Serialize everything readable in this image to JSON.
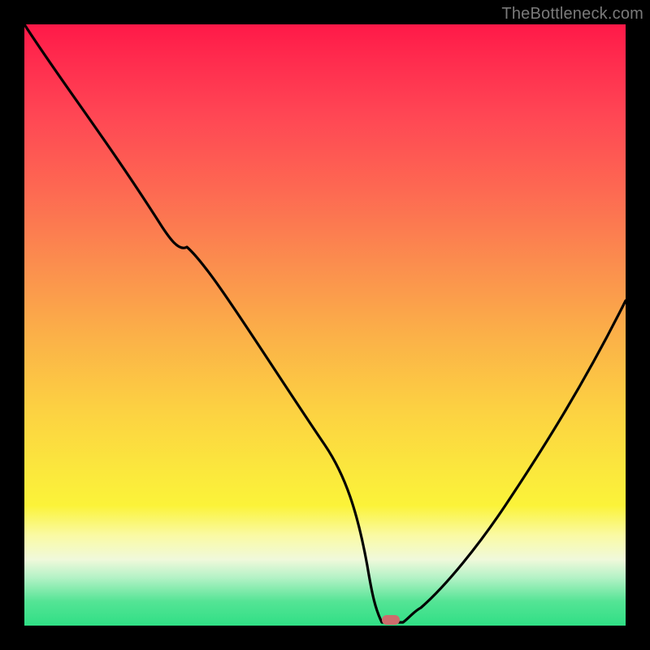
{
  "watermark": "TheBottleneck.com",
  "chart_data": {
    "type": "line",
    "title": "",
    "xlabel": "",
    "ylabel": "",
    "xlim": [
      0,
      100
    ],
    "ylim": [
      0,
      100
    ],
    "grid": false,
    "legend": false,
    "annotations": [],
    "series": [
      {
        "name": "bottleneck-curve",
        "x": [
          0,
          8,
          16,
          24,
          27,
          34,
          42,
          50,
          55,
          57,
          58,
          60,
          61,
          63,
          66,
          72,
          80,
          88,
          96,
          100
        ],
        "y": [
          100,
          88,
          77,
          66,
          63,
          56,
          44,
          30,
          18,
          10,
          4,
          0,
          0,
          0,
          3,
          9,
          20,
          33,
          47,
          54
        ]
      }
    ],
    "marker": {
      "x": 60.5,
      "y": 0.6,
      "color": "#cd6c6c"
    },
    "background_gradient_stops": [
      {
        "pos": 0.0,
        "color": "#ff1948"
      },
      {
        "pos": 0.06,
        "color": "#ff2c4e"
      },
      {
        "pos": 0.15,
        "color": "#ff4654"
      },
      {
        "pos": 0.28,
        "color": "#fd6a52"
      },
      {
        "pos": 0.4,
        "color": "#fb8e4e"
      },
      {
        "pos": 0.52,
        "color": "#fbb148"
      },
      {
        "pos": 0.64,
        "color": "#fcd142"
      },
      {
        "pos": 0.74,
        "color": "#fbe73d"
      },
      {
        "pos": 0.8,
        "color": "#fbf339"
      },
      {
        "pos": 0.85,
        "color": "#fafaa4"
      },
      {
        "pos": 0.89,
        "color": "#f0f9db"
      },
      {
        "pos": 0.92,
        "color": "#b4f2c6"
      },
      {
        "pos": 0.96,
        "color": "#54e495"
      },
      {
        "pos": 1.0,
        "color": "#30df85"
      }
    ]
  }
}
